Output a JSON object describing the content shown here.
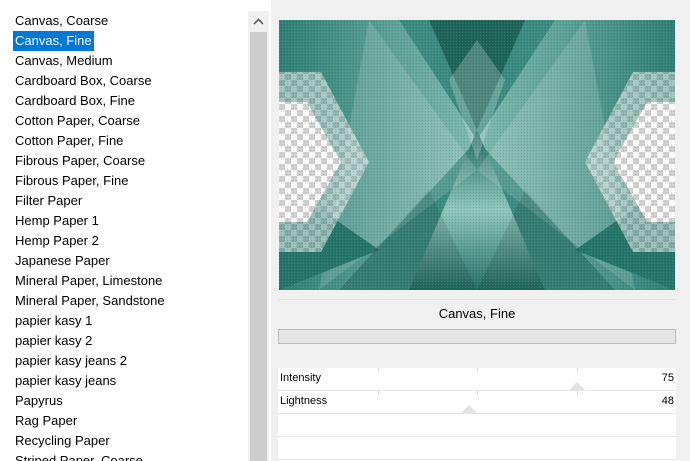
{
  "texture_list": {
    "items": [
      "Canvas, Coarse",
      "Canvas, Fine",
      "Canvas, Medium",
      "Cardboard Box, Coarse",
      "Cardboard Box, Fine",
      "Cotton Paper, Coarse",
      "Cotton Paper, Fine",
      "Fibrous Paper, Coarse",
      "Fibrous Paper, Fine",
      "Filter Paper",
      "Hemp Paper 1",
      "Hemp Paper 2",
      "Japanese Paper",
      "Mineral Paper, Limestone",
      "Mineral Paper, Sandstone",
      "papier kasy 1",
      "papier kasy 2",
      "papier kasy jeans 2",
      "papier kasy jeans",
      "Papyrus",
      "Rag Paper",
      "Recycling Paper",
      "Striped Paper, Coarse"
    ],
    "selected_index": 1,
    "selected_color": "#0078d7"
  },
  "scrollbar": {
    "up_icon": "chevron-up-icon"
  },
  "preview": {
    "base_color": "#3b8b80"
  },
  "caption": {
    "selected_name": "Canvas, Fine"
  },
  "progress": {
    "fraction": 0
  },
  "parameters": [
    {
      "label": "Intensity",
      "value": "75",
      "fraction": 0.75
    },
    {
      "label": "Lightness",
      "value": "48",
      "fraction": 0.48
    }
  ]
}
